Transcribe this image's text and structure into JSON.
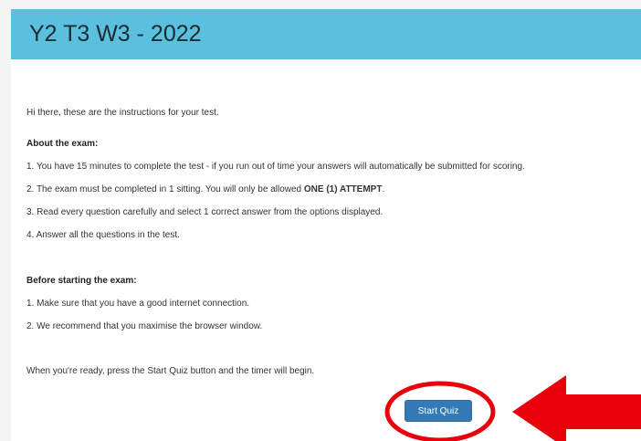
{
  "header": {
    "title": "Y2 T3 W3 - 2022"
  },
  "instructions": {
    "intro": "Hi there, these are the instructions for your test.",
    "about_heading": "About the exam:",
    "about_items": [
      "1. You have 15 minutes to complete the test - if you run out of time your answers will automatically be submitted for scoring.",
      {
        "before": "2. The exam must be completed in 1 sitting. You will only be allowed ",
        "emphasis": "ONE (1) ATTEMPT",
        "after": "."
      },
      "3. Read every question carefully and select 1 correct answer from the options displayed.",
      "4. Answer all the questions in the test."
    ],
    "before_heading": "Before starting the exam:",
    "before_items": [
      "1. Make sure that you have a good internet connection.",
      "2. We recommend that you maximise the browser window."
    ],
    "ready_text": "When you're ready, press the Start Quiz button and the timer will begin."
  },
  "actions": {
    "start_label": "Start Quiz"
  },
  "colors": {
    "header_bg": "#5bc0de",
    "button_bg": "#337ab7",
    "annotation_red": "#e8000b"
  }
}
